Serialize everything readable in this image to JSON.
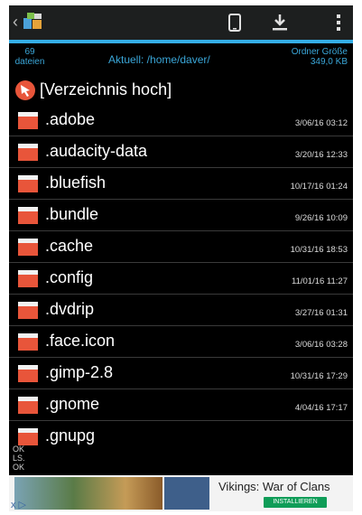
{
  "header": {
    "back": "‹"
  },
  "info": {
    "count_number": "69",
    "count_label": "dateien",
    "path": "Aktuell: /home/daver/",
    "size_label": "Ordner Größe",
    "size_value": "349,0 KB"
  },
  "parent_label": "[Verzeichnis hoch]",
  "folders": [
    {
      "name": ".adobe",
      "date": "3/06/16 03:12"
    },
    {
      "name": ".audacity-data",
      "date": "3/20/16 12:33"
    },
    {
      "name": ".bluefish",
      "date": "10/17/16 01:24"
    },
    {
      "name": ".bundle",
      "date": "9/26/16 10:09"
    },
    {
      "name": ".cache",
      "date": "10/31/16 18:53"
    },
    {
      "name": ".config",
      "date": "11/01/16 11:27"
    },
    {
      "name": ".dvdrip",
      "date": "3/27/16 01:31"
    },
    {
      "name": ".face.icon",
      "date": "3/06/16 03:28"
    },
    {
      "name": ".gimp-2.8",
      "date": "10/31/16 17:29"
    },
    {
      "name": ".gnome",
      "date": "4/04/16 17:17"
    },
    {
      "name": ".gnupg",
      "date": ""
    }
  ],
  "status": [
    "OK",
    "LS.",
    "OK"
  ],
  "ad": {
    "close": "x ▷",
    "title": "Vikings: War of Clans",
    "install": "INSTALLIEREN"
  },
  "colors": {
    "accent": "#35aee6",
    "folder": "#e8553a"
  }
}
